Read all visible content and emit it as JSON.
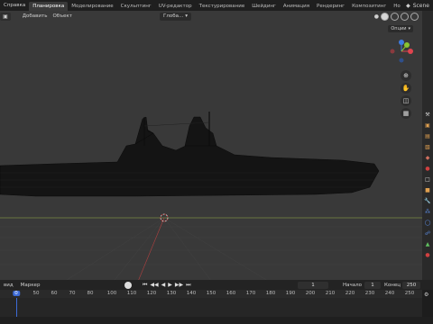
{
  "topbar": {
    "menus": [
      "Справка"
    ],
    "workspaces": [
      "Планировка",
      "Моделирование",
      "Скульптинг",
      "UV-редактор",
      "Текстурирование",
      "Шейдинг",
      "Анимация",
      "Рендеринг",
      "Композитинг",
      "Но"
    ],
    "active_workspace": "Планировка",
    "scene_label": "Scene"
  },
  "viewport": {
    "header": {
      "menus": [
        "Вид",
        "Добавить",
        "Объект"
      ],
      "orientation": "Глоба..."
    },
    "options_label": "Опции",
    "gizmo": {
      "x_color": "#e0444e",
      "y_color": "#8ac430",
      "z_color": "#3d7be0"
    }
  },
  "timeline": {
    "menus": [
      "вид",
      "Маркер"
    ],
    "current_frame": "1",
    "start_label": "Начало",
    "start_value": "1",
    "end_label": "Конец",
    "end_value": "250",
    "ruler_ticks": [
      "0",
      "50",
      "100",
      "110",
      "120",
      "130",
      "140",
      "150",
      "160",
      "170",
      "180",
      "190",
      "200",
      "210",
      "220",
      "230",
      "240",
      "250"
    ],
    "ruler_labels": [
      "0",
      "10",
      "20",
      "30",
      "40",
      "50",
      "60",
      "70",
      "80",
      "90",
      "100",
      "110",
      "120",
      "130",
      "140",
      "150",
      "160",
      "170",
      "180",
      "190",
      "200",
      "210",
      "220",
      "230",
      "240",
      "250"
    ]
  }
}
